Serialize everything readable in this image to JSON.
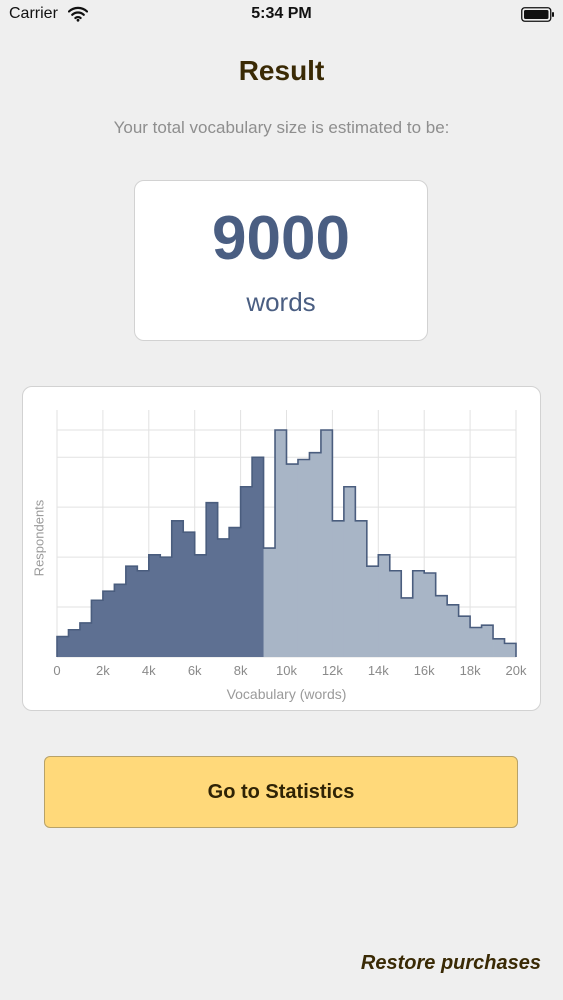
{
  "status_bar": {
    "carrier": "Carrier",
    "time": "5:34 PM",
    "icons": [
      "wifi-icon",
      "battery-icon"
    ]
  },
  "header": {
    "title": "Result",
    "subtitle": "Your total vocabulary size is estimated to be:"
  },
  "result": {
    "value": "9000",
    "unit": "words"
  },
  "chart_data": {
    "type": "bar",
    "subtype": "histogram",
    "title": "",
    "xlabel": "Vocabulary (words)",
    "ylabel": "Respondents",
    "xlim": [
      0,
      20000
    ],
    "ylim": [
      0,
      100
    ],
    "grid": true,
    "bin_width": 500,
    "highlight_upper_bound": 9000,
    "x_tick_labels": [
      "0",
      "2k",
      "4k",
      "6k",
      "8k",
      "10k",
      "12k",
      "14k",
      "16k",
      "18k",
      "20k"
    ],
    "x_tick_values": [
      0,
      2000,
      4000,
      6000,
      8000,
      10000,
      12000,
      14000,
      16000,
      18000,
      20000
    ],
    "y_grid_values": [
      0,
      22,
      44,
      66,
      88,
      100
    ],
    "series": [
      {
        "values": [
          9,
          12,
          15,
          25,
          29,
          32,
          40,
          38,
          45,
          44,
          60,
          55,
          45,
          68,
          52,
          57,
          75,
          88,
          48,
          100,
          85,
          87,
          90,
          100,
          60,
          75,
          60,
          40,
          45,
          38,
          26,
          38,
          37,
          27,
          23,
          18,
          13,
          14,
          8,
          6
        ]
      }
    ],
    "colors": {
      "highlight_fill": "#5e7092",
      "highlight_stroke": "#49597a",
      "rest_fill": "#a8b5c6",
      "rest_stroke": "#4a5d7e",
      "grid": "#e2e2e2"
    }
  },
  "actions": {
    "stats_button": "Go to Statistics",
    "restore": "Restore purchases"
  },
  "colors": {
    "background": "#efefef",
    "title": "#3a2a05",
    "accent": "#4a5e82",
    "button": "#ffd97a"
  }
}
